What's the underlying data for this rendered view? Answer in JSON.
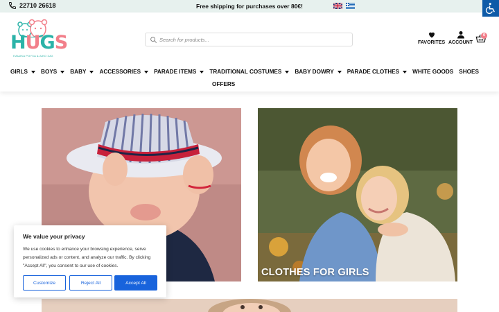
{
  "topbar": {
    "phone": "22710 26618",
    "shipping": "Free shipping for purchases over 80€!",
    "languages": [
      "English",
      "Greek"
    ],
    "phone_icon": "phone-icon",
    "accessibility_icon": "wheelchair-icon"
  },
  "header": {
    "logo": {
      "word": "HUGS",
      "letters": [
        "H",
        "U",
        "G",
        "S"
      ],
      "tagline": "ΠΑΙΔΙΚΑ ΡΟΥΧΑ & ΔΙΚΟ ΣΑΣ"
    },
    "search": {
      "placeholder": "Search for products..."
    },
    "favorites_label": "FAVORITES",
    "account_label": "ACCOUNT",
    "cart_count": "0"
  },
  "nav": {
    "items": [
      {
        "label": "GIRLS",
        "dropdown": true
      },
      {
        "label": "BOYS",
        "dropdown": true
      },
      {
        "label": "BABY",
        "dropdown": true
      },
      {
        "label": "ACCESSORIES",
        "dropdown": true
      },
      {
        "label": "PARADE ITEMS",
        "dropdown": true
      },
      {
        "label": "TRADITIONAL COSTUMES",
        "dropdown": true
      },
      {
        "label": "BABY DOWRY",
        "dropdown": true
      },
      {
        "label": "PARADE CLOTHES",
        "dropdown": true
      },
      {
        "label": "WHITE GOODS",
        "dropdown": false
      },
      {
        "label": "SHOES",
        "dropdown": false
      }
    ],
    "row2": {
      "label": "OFFERS"
    }
  },
  "tiles": {
    "girls_label": "CLOTHES FOR GIRLS"
  },
  "cookie": {
    "title": "We value your privacy",
    "text": "We use cookies to enhance your browsing experience, serve personalized ads or content, and analyze our traffic. By clicking \"Accept All\", you consent to our use of cookies.",
    "customize": "Customize",
    "reject": "Reject All",
    "accept": "Accept All"
  },
  "colors": {
    "teal": "#2bb3a8",
    "pink": "#f27f8a",
    "topbar_bg": "#e7f1ee",
    "primary_blue": "#1863dc",
    "access_blue": "#0e5ba8"
  }
}
